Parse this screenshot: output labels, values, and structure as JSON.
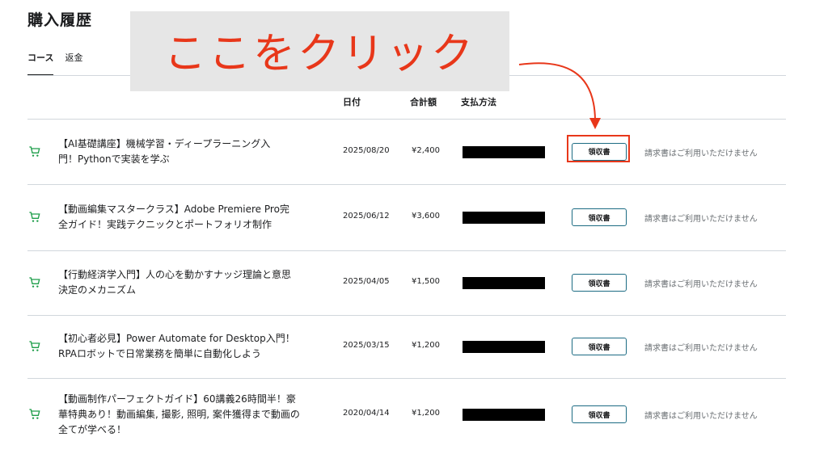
{
  "page": {
    "title": "購入履歴"
  },
  "tabs": [
    {
      "label": "コース",
      "active": true
    },
    {
      "label": "返金",
      "active": false
    }
  ],
  "table": {
    "headers": {
      "date": "日付",
      "total": "合計額",
      "payment": "支払方法"
    },
    "rows": [
      {
        "title_lines": [
          "【AI基礎講座】機械学習・ディープラーニング入",
          "門！Pythonで実装を学ぶ"
        ],
        "date": "2025/08/20",
        "amount": "¥2,400",
        "receipt_label": "領収書",
        "invoice_note": "請求書はご利用いただけません"
      },
      {
        "title_lines": [
          "【動画編集マスタークラス】Adobe Premiere Pro完",
          "全ガイド！実践テクニックとポートフォリオ制作"
        ],
        "date": "2025/06/12",
        "amount": "¥3,600",
        "receipt_label": "領収書",
        "invoice_note": "請求書はご利用いただけません"
      },
      {
        "title_lines": [
          "【行動経済学入門】人の心を動かすナッジ理論と意思",
          "決定のメカニズム"
        ],
        "date": "2025/04/05",
        "amount": "¥1,500",
        "receipt_label": "領収書",
        "invoice_note": "請求書はご利用いただけません"
      },
      {
        "title_lines": [
          "【初心者必見】Power Automate for Desktop入門！",
          "RPAロボットで日常業務を簡単に自動化しよう"
        ],
        "date": "2025/03/15",
        "amount": "¥1,200",
        "receipt_label": "領収書",
        "invoice_note": "請求書はご利用いただけません"
      },
      {
        "title_lines": [
          "【動画制作パーフェクトガイド】60講義26時間半！豪",
          "華特典あり！動画編集, 撮影, 照明, 案件獲得まで動画の",
          "全てが学べる！"
        ],
        "date": "2020/04/14",
        "amount": "¥1,200",
        "receipt_label": "領収書",
        "invoice_note": "請求書はご利用いただけません"
      }
    ]
  },
  "annotation": {
    "text": "ここをクリック",
    "color": "#e8371a"
  },
  "icons": {
    "row_icon": "cart-icon",
    "cart_color": "#1e9e4a"
  },
  "colors": {
    "button_border": "#1c6b83",
    "divider": "#d1d7dc",
    "muted_text": "#6a6f73"
  }
}
